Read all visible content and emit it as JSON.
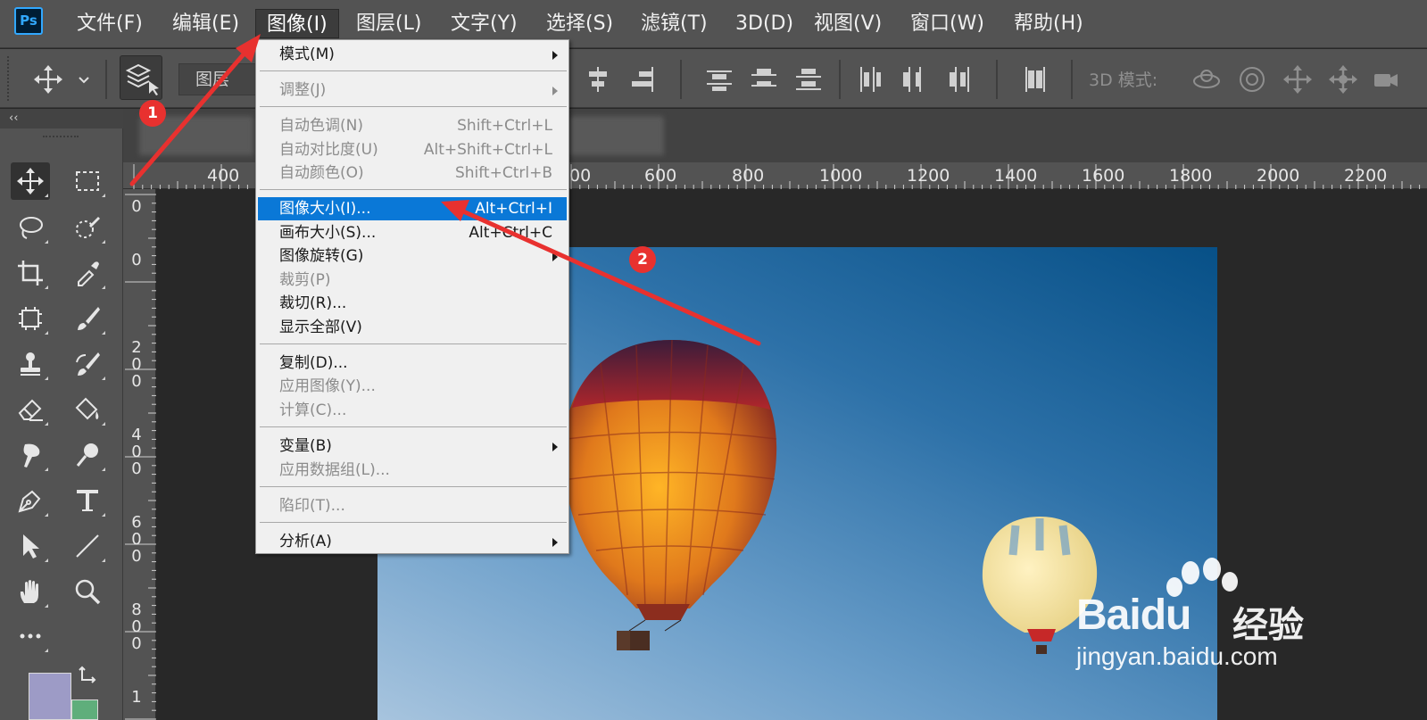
{
  "app": {
    "logo": "Ps"
  },
  "menubar": {
    "items": [
      {
        "label": "文件(F)"
      },
      {
        "label": "编辑(E)"
      },
      {
        "label": "图像(I)"
      },
      {
        "label": "图层(L)"
      },
      {
        "label": "文字(Y)"
      },
      {
        "label": "选择(S)"
      },
      {
        "label": "滤镜(T)"
      },
      {
        "label": "3D(D)"
      },
      {
        "label": "视图(V)"
      },
      {
        "label": "窗口(W)"
      },
      {
        "label": "帮助(H)"
      }
    ],
    "active": "图像(I)"
  },
  "options_bar": {
    "auto_select_value": "图层",
    "mode_3d_label": "3D 模式:"
  },
  "panel_collapse": "‹‹",
  "ruler_h": [
    "400",
    "00",
    "600",
    "800",
    "1000",
    "1200",
    "1400",
    "1600",
    "1800",
    "2000",
    "2200"
  ],
  "ruler_v": [
    {
      "digits": [
        "0"
      ]
    },
    {
      "digits": [
        "0"
      ]
    },
    {
      "digits": [
        "2",
        "0",
        "0"
      ]
    },
    {
      "digits": [
        "4",
        "0",
        "0"
      ]
    },
    {
      "digits": [
        "6",
        "0",
        "0"
      ]
    },
    {
      "digits": [
        "8",
        "0",
        "0"
      ]
    },
    {
      "digits": [
        "1"
      ]
    }
  ],
  "image_menu": {
    "items": [
      {
        "label": "模式(M)",
        "shortcut": "",
        "submenu": true,
        "disabled": false,
        "highlight": false
      },
      {
        "label": "调整(J)",
        "shortcut": "",
        "submenu": true,
        "disabled": true,
        "highlight": false
      },
      {
        "label": "自动色调(N)",
        "shortcut": "Shift+Ctrl+L",
        "submenu": false,
        "disabled": true,
        "highlight": false
      },
      {
        "label": "自动对比度(U)",
        "shortcut": "Alt+Shift+Ctrl+L",
        "submenu": false,
        "disabled": true,
        "highlight": false
      },
      {
        "label": "自动颜色(O)",
        "shortcut": "Shift+Ctrl+B",
        "submenu": false,
        "disabled": true,
        "highlight": false
      },
      {
        "label": "图像大小(I)...",
        "shortcut": "Alt+Ctrl+I",
        "submenu": false,
        "disabled": false,
        "highlight": true
      },
      {
        "label": "画布大小(S)...",
        "shortcut": "Alt+Ctrl+C",
        "submenu": false,
        "disabled": false,
        "highlight": false
      },
      {
        "label": "图像旋转(G)",
        "shortcut": "",
        "submenu": true,
        "disabled": false,
        "highlight": false
      },
      {
        "label": "裁剪(P)",
        "shortcut": "",
        "submenu": false,
        "disabled": true,
        "highlight": false
      },
      {
        "label": "裁切(R)...",
        "shortcut": "",
        "submenu": false,
        "disabled": false,
        "highlight": false
      },
      {
        "label": "显示全部(V)",
        "shortcut": "",
        "submenu": false,
        "disabled": false,
        "highlight": false
      },
      {
        "label": "复制(D)...",
        "shortcut": "",
        "submenu": false,
        "disabled": false,
        "highlight": false
      },
      {
        "label": "应用图像(Y)...",
        "shortcut": "",
        "submenu": false,
        "disabled": true,
        "highlight": false
      },
      {
        "label": "计算(C)...",
        "shortcut": "",
        "submenu": false,
        "disabled": true,
        "highlight": false
      },
      {
        "label": "变量(B)",
        "shortcut": "",
        "submenu": true,
        "disabled": false,
        "highlight": false
      },
      {
        "label": "应用数据组(L)...",
        "shortcut": "",
        "submenu": false,
        "disabled": true,
        "highlight": false
      },
      {
        "label": "陷印(T)...",
        "shortcut": "",
        "submenu": false,
        "disabled": true,
        "highlight": false
      },
      {
        "label": "分析(A)",
        "shortcut": "",
        "submenu": true,
        "disabled": false,
        "highlight": false
      }
    ]
  },
  "annotations": {
    "step1": "1",
    "step2": "2",
    "color": "#e8312f"
  },
  "tools": [
    "move-tool-icon",
    "marquee-tool-icon",
    "lasso-tool-icon",
    "quick-selection-tool-icon",
    "crop-tool-icon",
    "eyedropper-tool-icon",
    "frame-tool-icon",
    "brush-tool-icon",
    "stamp-tool-icon",
    "history-brush-tool-icon",
    "eraser-tool-icon",
    "paint-bucket-tool-icon",
    "smudge-tool-icon",
    "dodge-tool-icon",
    "pen-tool-icon",
    "type-tool-icon",
    "path-selection-tool-icon",
    "line-tool-icon",
    "hand-tool-icon",
    "zoom-tool-icon",
    "more-tools-icon"
  ],
  "colors": {
    "foreground": "#9d9bc6",
    "background": "#5fae7b",
    "highlight": "#0a78d7"
  },
  "watermark": {
    "brand": "Bai",
    "brand_suffix": "du",
    "cn": "经验",
    "url": "jingyan.baidu.com"
  }
}
